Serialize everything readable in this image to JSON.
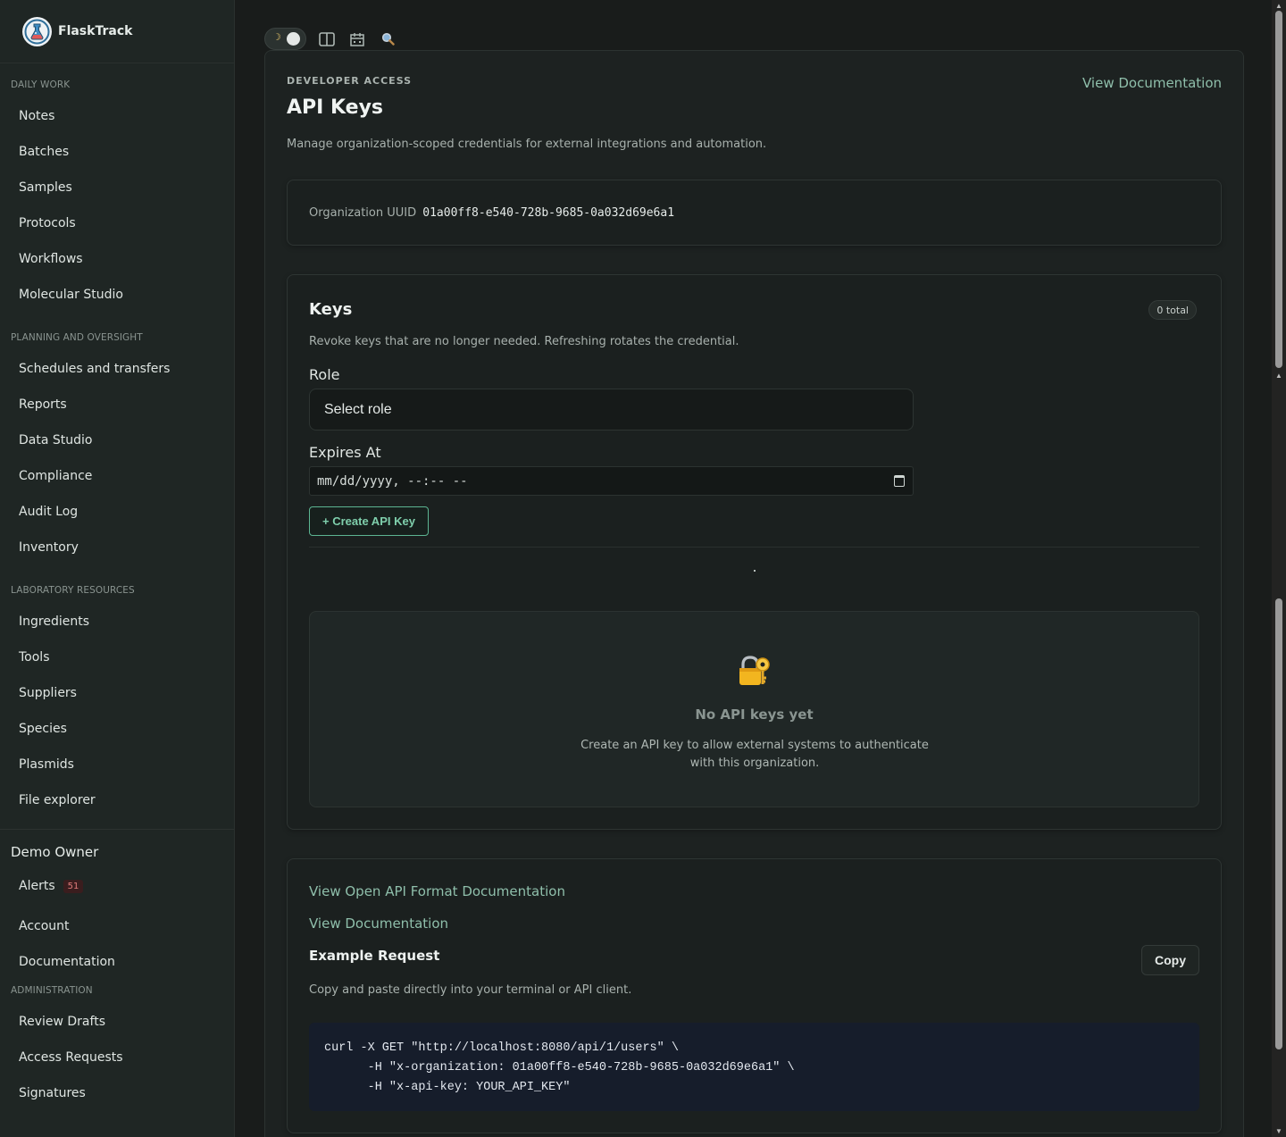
{
  "brand": {
    "name": "FlaskTrack"
  },
  "sidebar": {
    "sections": [
      {
        "label": "DAILY WORK",
        "items": [
          "Notes",
          "Batches",
          "Samples",
          "Protocols",
          "Workflows",
          "Molecular Studio"
        ]
      },
      {
        "label": "PLANNING AND OVERSIGHT",
        "items": [
          "Schedules and transfers",
          "Reports",
          "Data Studio",
          "Compliance",
          "Audit Log",
          "Inventory"
        ]
      },
      {
        "label": "LABORATORY RESOURCES",
        "items": [
          "Ingredients",
          "Tools",
          "Suppliers",
          "Species",
          "Plasmids",
          "File explorer"
        ]
      }
    ],
    "user": {
      "name": "Demo Owner",
      "alerts_label": "Alerts",
      "alerts_count": "51",
      "account_label": "Account",
      "documentation_label": "Documentation"
    },
    "admin": {
      "label": "ADMINISTRATION",
      "items": [
        "Review Drafts",
        "Access Requests",
        "Signatures"
      ]
    }
  },
  "toolbar": {
    "icons": [
      "moon-icon",
      "split-view-icon",
      "calendar-grid-icon",
      "search-icon"
    ]
  },
  "header": {
    "eyebrow": "DEVELOPER ACCESS",
    "title": "API Keys",
    "doc_link": "View Documentation",
    "subtitle": "Manage organization-scoped credentials for external integrations and automation."
  },
  "org": {
    "label": "Organization UUID",
    "uuid": "01a00ff8-e540-728b-9685-0a032d69e6a1"
  },
  "keys": {
    "title": "Keys",
    "count_label": "0 total",
    "subtitle": "Revoke keys that are no longer needed. Refreshing rotates the credential.",
    "role_label": "Role",
    "role_placeholder": "Select role",
    "expires_label": "Expires At",
    "expires_placeholder": "mm/dd/yyyy, --:-- --",
    "create_button": "+ Create API Key",
    "empty_title": "No API keys yet",
    "empty_text": "Create an API key to allow external systems to authenticate with this organization."
  },
  "docs": {
    "openapi_link": "View Open API Format Documentation",
    "doc_link": "View Documentation",
    "example_title": "Example Request",
    "copy_label": "Copy",
    "example_sub": "Copy and paste directly into your terminal or API client.",
    "code": "curl -X GET \"http://localhost:8080/api/1/users\" \\\n      -H \"x-organization: 01a00ff8-e540-728b-9685-0a032d69e6a1\" \\\n      -H \"x-api-key: YOUR_API_KEY\""
  },
  "colors": {
    "accent": "#8fbfab",
    "button_border": "#5cb592",
    "code_bg": "#161d2b",
    "badge": "#e07b7b"
  }
}
